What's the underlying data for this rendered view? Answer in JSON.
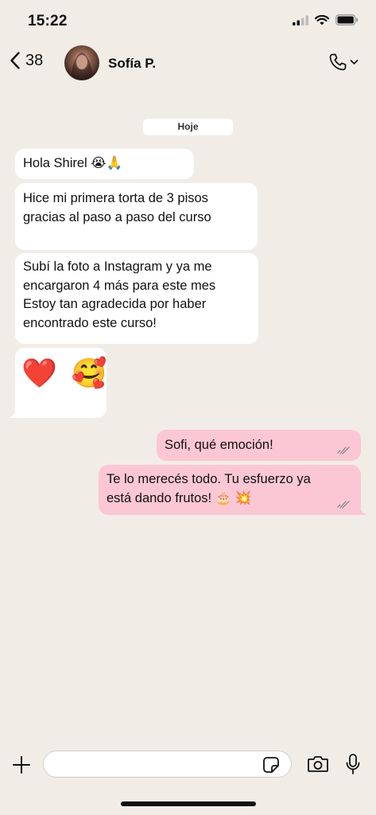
{
  "status_bar": {
    "time": "15:22",
    "icons": [
      "cellular-signal-icon",
      "wifi-icon",
      "battery-icon"
    ]
  },
  "header": {
    "back_count": "38",
    "contact_name": "Sofía P.",
    "icons": [
      "chevron-left-icon",
      "phone-icon",
      "chevron-down-icon"
    ]
  },
  "date_label": "Hoje",
  "messages": [
    {
      "direction": "incoming",
      "lines": [
        "Hola Shirel 😭🙏"
      ]
    },
    {
      "direction": "incoming",
      "lines": [
        "Hice mi primera torta de 3 pisos",
        "gracias al paso a paso del curso"
      ]
    },
    {
      "direction": "incoming",
      "lines": [
        "Subí la foto a Instagram y ya me",
        "encargaron 4 más para este mes",
        "Estoy tan agradecida por haber",
        "encontrado este curso!"
      ]
    },
    {
      "direction": "incoming",
      "lines": [
        "❤️ 🥰"
      ]
    },
    {
      "direction": "outgoing",
      "lines": [
        "Sofi, qué emoción!"
      ],
      "status": "read-double-check"
    },
    {
      "direction": "outgoing",
      "lines": [
        "Te lo merecés todo. Tu esfuerzo ya",
        "está dando frutos! 🎂 💥"
      ],
      "status": "read-double-check"
    }
  ],
  "colors": {
    "background": "#f1ede6",
    "incoming_bubble": "#ffffff",
    "outgoing_bubble": "#fbc7d4",
    "tick": "#8a8a8a"
  },
  "input_bar": {
    "placeholder": "",
    "icons": [
      "plus-icon",
      "sticker-icon",
      "camera-icon",
      "microphone-icon"
    ]
  }
}
